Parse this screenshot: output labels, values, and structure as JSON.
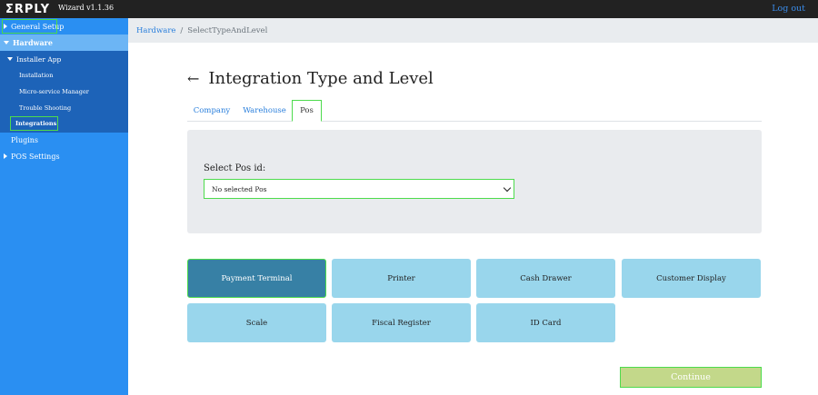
{
  "topbar": {
    "logo": "ΣRPLY",
    "version": "Wizard v1.1.36",
    "logout": "Log out"
  },
  "sidebar": {
    "general_setup": "General Setup",
    "hardware": "Hardware",
    "installer_app": "Installer App",
    "installation": "Installation",
    "micro_service_manager": "Micro-service Manager",
    "trouble_shooting": "Trouble Shooting",
    "integrations": "Integrations",
    "plugins": "Plugins",
    "pos_settings": "POS Settings"
  },
  "breadcrumb": {
    "hardware": "Hardware",
    "separator": "/",
    "current": "SelectTypeAndLevel"
  },
  "page": {
    "back_icon": "←",
    "title": "Integration Type and Level"
  },
  "tabs": {
    "company": "Company",
    "warehouse": "Warehouse",
    "pos": "Pos",
    "active": "Pos"
  },
  "form": {
    "select_label": "Select Pos id:",
    "select_value": "No selected Pos"
  },
  "types": {
    "payment_terminal": "Payment Terminal",
    "printer": "Printer",
    "cash_drawer": "Cash Drawer",
    "customer_display": "Customer Display",
    "scale": "Scale",
    "fiscal_register": "Fiscal Register",
    "id_card": "ID Card",
    "selected": "Payment Terminal"
  },
  "actions": {
    "continue": "Continue"
  },
  "colors": {
    "sidebar": "#2a8ff2",
    "sidebar_sub": "#1d63b8",
    "highlight": "#4ddb4d",
    "type_button": "#99d6ec",
    "type_button_active": "#3780a5",
    "continue": "#c3d88a"
  }
}
